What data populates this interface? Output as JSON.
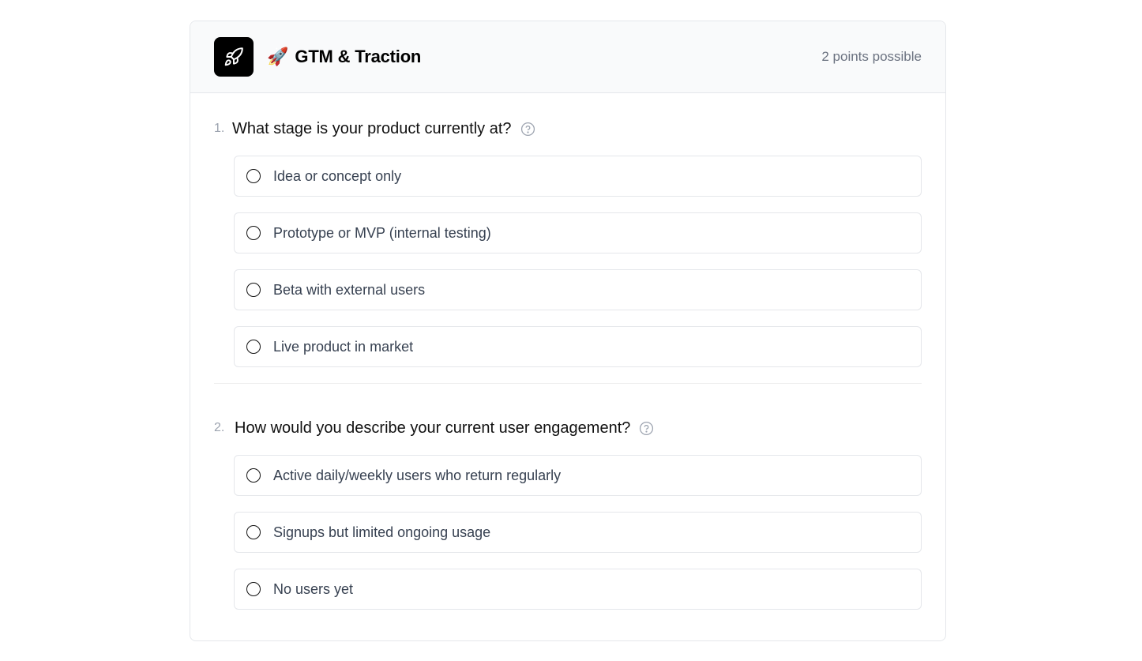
{
  "section": {
    "emoji": "🚀",
    "title": "GTM & Traction",
    "points": "2 points possible",
    "icon": "rocket-icon"
  },
  "questions": [
    {
      "number": "1.",
      "title": "What stage is your product currently at?",
      "options": [
        "Idea or concept only",
        "Prototype or MVP (internal testing)",
        "Beta with external users",
        "Live product in market"
      ]
    },
    {
      "number": "2.",
      "title": "How would you describe your current user engagement?",
      "options": [
        "Active daily/weekly users who return regularly",
        "Signups but limited ongoing usage",
        "No users yet"
      ]
    }
  ]
}
